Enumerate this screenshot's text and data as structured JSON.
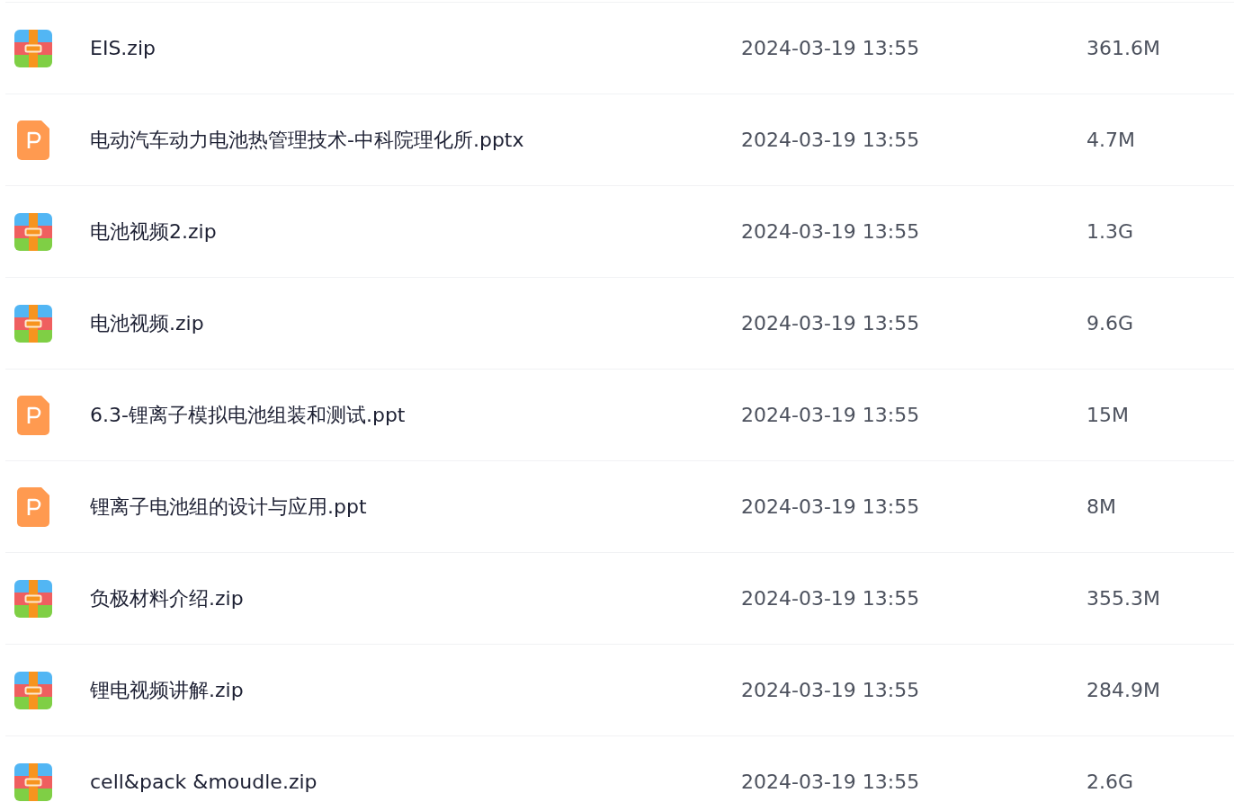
{
  "files": [
    {
      "kind": "zip",
      "name": "EIS.zip",
      "modified": "2024-03-19 13:55",
      "size": "361.6M"
    },
    {
      "kind": "ppt",
      "name": "电动汽车动力电池热管理技术-中科院理化所.pptx",
      "modified": "2024-03-19 13:55",
      "size": "4.7M"
    },
    {
      "kind": "zip",
      "name": "电池视频2.zip",
      "modified": "2024-03-19 13:55",
      "size": "1.3G"
    },
    {
      "kind": "zip",
      "name": "电池视频.zip",
      "modified": "2024-03-19 13:55",
      "size": "9.6G"
    },
    {
      "kind": "ppt",
      "name": "6.3-锂离子模拟电池组装和测试.ppt",
      "modified": "2024-03-19 13:55",
      "size": "15M"
    },
    {
      "kind": "ppt",
      "name": "锂离子电池组的设计与应用.ppt",
      "modified": "2024-03-19 13:55",
      "size": "8M"
    },
    {
      "kind": "zip",
      "name": "负极材料介绍.zip",
      "modified": "2024-03-19 13:55",
      "size": "355.3M"
    },
    {
      "kind": "zip",
      "name": "锂电视频讲解.zip",
      "modified": "2024-03-19 13:55",
      "size": "284.9M"
    },
    {
      "kind": "zip",
      "name": "cell&pack &moudle.zip",
      "modified": "2024-03-19 13:55",
      "size": "2.6G"
    }
  ]
}
